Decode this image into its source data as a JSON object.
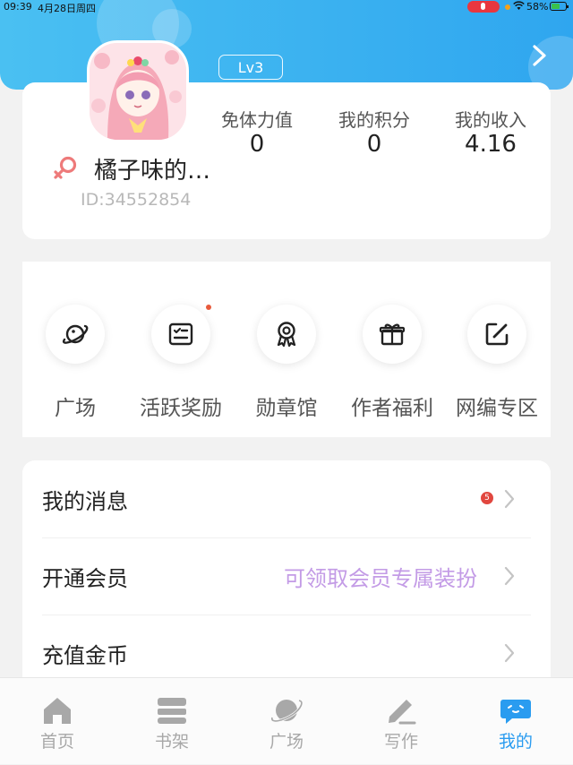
{
  "status_bar": {
    "time": "09:39",
    "date": "4月28日周四",
    "battery": "58%"
  },
  "header": {
    "level_badge": "Lv3"
  },
  "profile": {
    "username": "橘子味的…",
    "user_id": "ID:34552854",
    "stats": [
      {
        "label": "免体力值",
        "value": "0"
      },
      {
        "label": "我的积分",
        "value": "0"
      },
      {
        "label": "我的收入",
        "value": "4.16"
      }
    ]
  },
  "quick_grid": [
    {
      "label": "广场",
      "icon": "planet-icon"
    },
    {
      "label": "活跃奖励",
      "icon": "checklist-icon"
    },
    {
      "label": "勋章馆",
      "icon": "medal-icon"
    },
    {
      "label": "作者福利",
      "icon": "gift-icon"
    },
    {
      "label": "网编专区",
      "icon": "edit-icon"
    }
  ],
  "menu": [
    {
      "label": "我的消息",
      "badge": "5",
      "hint": ""
    },
    {
      "label": "开通会员",
      "badge": "",
      "hint": "可领取会员专属装扮"
    },
    {
      "label": "充值金币",
      "badge": "",
      "hint": ""
    }
  ],
  "tabs": [
    {
      "label": "首页",
      "icon": "home-icon"
    },
    {
      "label": "书架",
      "icon": "bookshelf-icon"
    },
    {
      "label": "广场",
      "icon": "planet-icon"
    },
    {
      "label": "写作",
      "icon": "pen-icon"
    },
    {
      "label": "我的",
      "icon": "chat-face-icon",
      "active": true
    }
  ],
  "colors": {
    "header_start": "#4ac0f2",
    "header_end": "#2fa6ef",
    "active_tab": "#2a9cf0",
    "vip_hint": "#c39be6",
    "badge": "#e1473f"
  }
}
